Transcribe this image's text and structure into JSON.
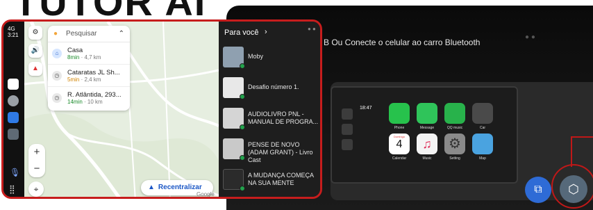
{
  "brand_text": "TUTOR AI",
  "background": {
    "caption": "B  Ou Conecte o celular ao carro Bluetooth",
    "carplay": {
      "time": "18:47",
      "apps": [
        {
          "name": "Phone",
          "color": "#27c24c"
        },
        {
          "name": "Message",
          "color": "#2fc45a"
        },
        {
          "name": "QQ music",
          "color": "#28b24b"
        },
        {
          "name": "Car",
          "color": "#4a4a4a"
        },
        {
          "name": "Calendar",
          "day_label": "Domingo",
          "day_number": "4",
          "color": "#ffffff"
        },
        {
          "name": "Music",
          "color": "#f4f4f4"
        },
        {
          "name": "Setting",
          "color": "#8a8a8a"
        },
        {
          "name": "Map",
          "color": "#4aa3e0"
        }
      ]
    },
    "buttons": {
      "cast_icon": "cast-icon",
      "home_icon": "hexagon-home-icon"
    },
    "accent_red": "#c01818"
  },
  "android_auto": {
    "status": {
      "signal": "4G",
      "time": "3:21"
    },
    "rail_apps": [
      {
        "name": "maps",
        "color": "#ffffff"
      },
      {
        "name": "assistant",
        "color": "#9aa0a6"
      },
      {
        "name": "phone",
        "color": "#2f7ae5"
      },
      {
        "name": "settings",
        "color": "#5f6a75"
      }
    ],
    "map": {
      "search_label": "Pesquisar",
      "destinations": [
        {
          "name": "Casa",
          "eta": "8min",
          "distance": "· 4,7 km",
          "eta_color": "green",
          "icon": "home-icon"
        },
        {
          "name": "Cataratas JL Sh...",
          "eta": "5min",
          "distance": "· 2,4 km",
          "eta_color": "orange",
          "icon": "history-icon"
        },
        {
          "name": "R. Atlântida, 293...",
          "eta": "14min",
          "distance": "· 10 km",
          "eta_color": "green",
          "icon": "history-icon"
        }
      ],
      "zoom_in": "+",
      "zoom_out": "−",
      "recenter_label": "Recentralizar",
      "attribution": "Google"
    },
    "music": {
      "header": "Para você",
      "header_chevron": "›",
      "tracks": [
        {
          "title": "Moby",
          "cover": "#8fa0b0"
        },
        {
          "title": "Desafio número 1.",
          "cover": "#e8e8e8"
        },
        {
          "title": "AUDIOLIVRO PNL - MANUAL DE PROGRA...",
          "cover": "#d5d5d5"
        },
        {
          "title": "PENSE DE NOVO (ADAM GRANT) - Livro Cast",
          "cover": "#c9c9c9"
        },
        {
          "title": "A MUDANÇA COMEÇA NA SUA MENTE",
          "cover": "#2b2b2b"
        }
      ]
    }
  }
}
